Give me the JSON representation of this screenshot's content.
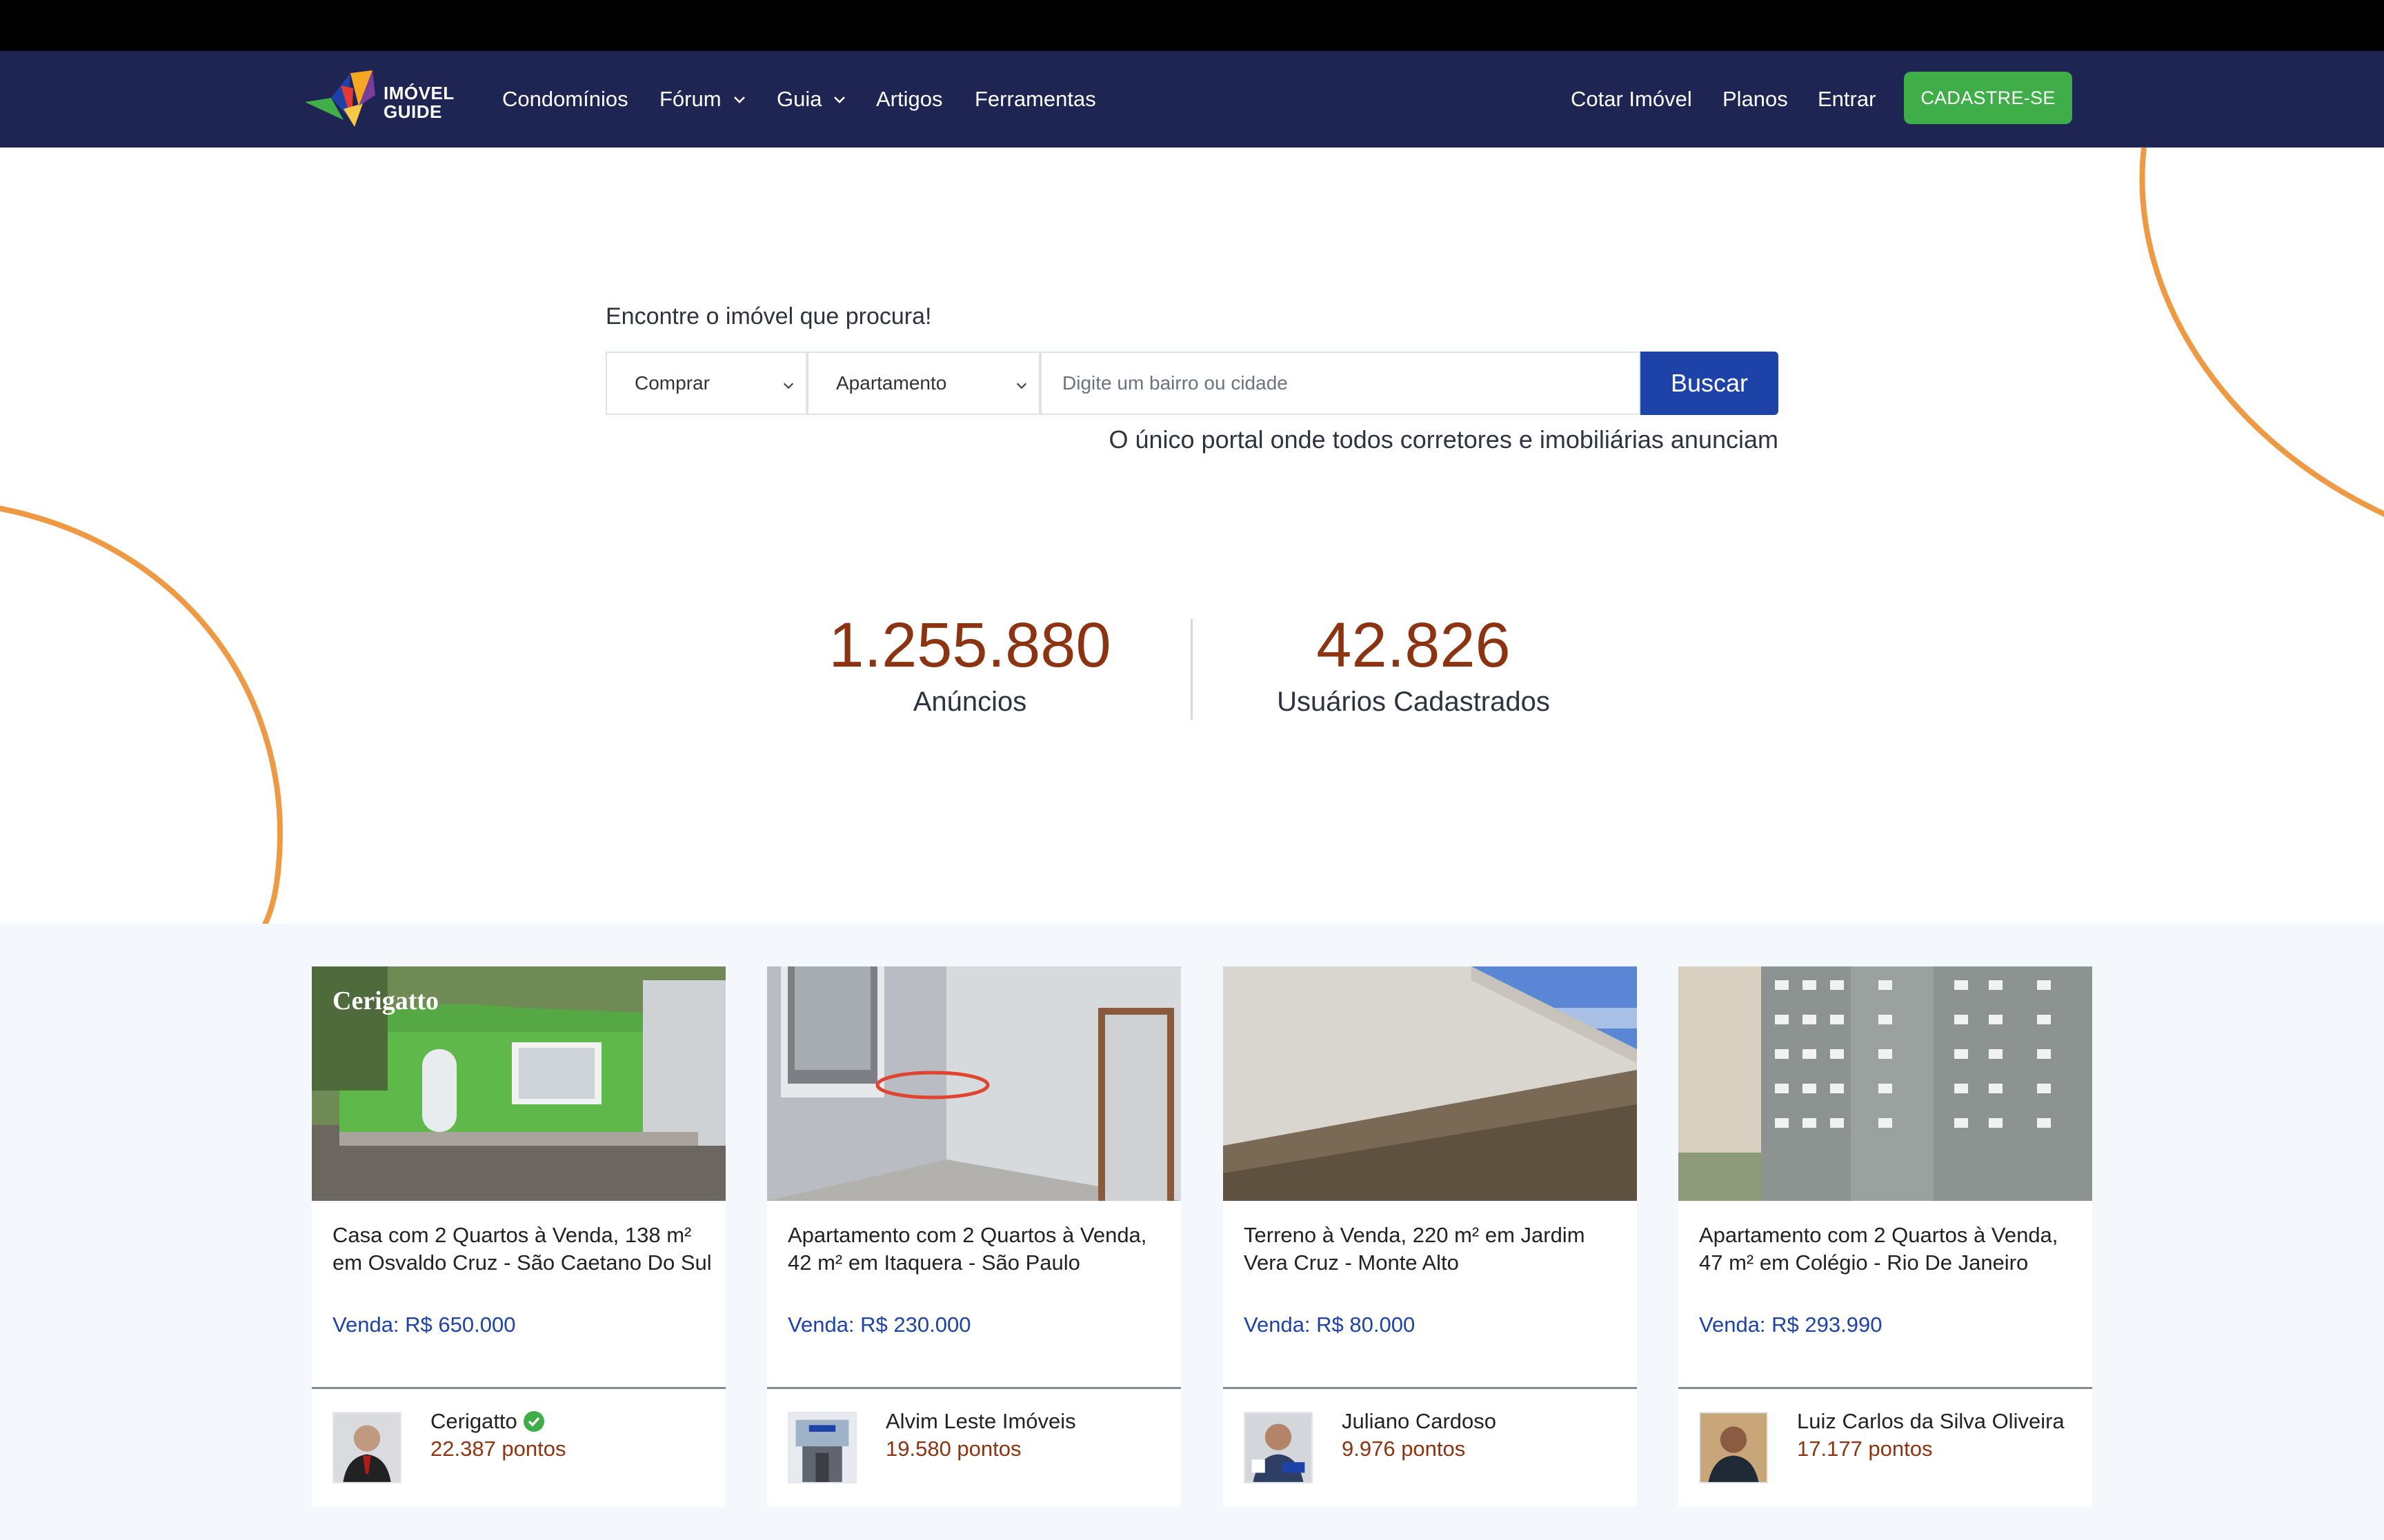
{
  "nav": {
    "logo_line1": "IMÓVEL",
    "logo_line2": "GUIDE",
    "links_left": [
      "Condomínios",
      "Fórum",
      "Guia",
      "Artigos",
      "Ferramentas"
    ],
    "links_right": [
      "Cotar Imóvel",
      "Planos",
      "Entrar"
    ],
    "signup_label": "CADASTRE-SE"
  },
  "search": {
    "title": "Encontre o imóvel que procura!",
    "transaction_selected": "Comprar",
    "type_selected": "Apartamento",
    "placeholder": "Digite um bairro ou cidade",
    "button_label": "Buscar",
    "tagline": "O único portal onde todos corretores e imobiliárias anunciam"
  },
  "stats": {
    "ads_count": "1.255.880",
    "ads_label": "Anúncios",
    "users_count": "42.826",
    "users_label": "Usuários Cadastrados"
  },
  "listings": [
    {
      "title": "Casa com 2 Quartos à Venda, 138 m² em Osvaldo Cruz - São Caetano Do Sul",
      "price": "Venda: R$ 650.000",
      "agent": "Cerigatto",
      "points": "22.387 pontos",
      "watermark": "Cerigatto",
      "verified": true
    },
    {
      "title": "Apartamento com 2 Quartos à Venda, 42 m² em Itaquera - São Paulo",
      "price": "Venda: R$ 230.000",
      "agent": "Alvim Leste Imóveis",
      "points": "19.580 pontos"
    },
    {
      "title": "Terreno à Venda, 220 m² em Jardim Vera Cruz - Monte Alto",
      "price": "Venda: R$ 80.000",
      "agent": "Juliano Cardoso",
      "points": "9.976 pontos"
    },
    {
      "title": "Apartamento com 2 Quartos à Venda, 47 m² em Colégio - Rio De Janeiro",
      "price": "Venda: R$ 293.990",
      "agent": "Luiz Carlos da Silva Oliveira",
      "points": "17.177 pontos"
    }
  ],
  "colors": {
    "nav_bg": "#1e2552",
    "signup_green": "#3fae49",
    "button_blue": "#1d43a8",
    "stat_brown": "#8c3412",
    "arc_orange": "#ee9a45"
  }
}
